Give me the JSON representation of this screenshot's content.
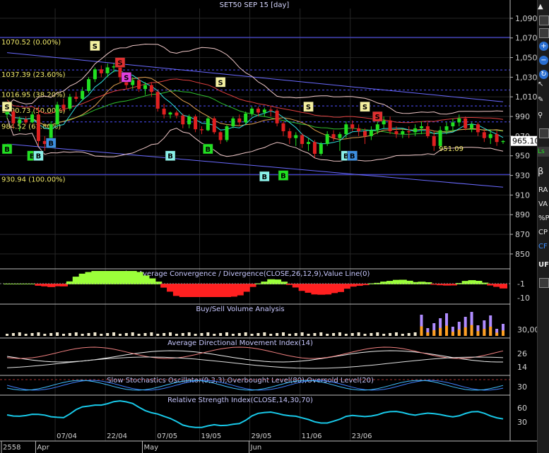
{
  "chart_data": {
    "type": "candlestick",
    "title": "SET50 SEP 15   [day]",
    "price_ylim": [
      837,
      1100
    ],
    "price_ticks": [
      1090,
      1070,
      1050,
      1030,
      1010,
      990,
      970,
      950,
      930,
      910,
      890,
      870,
      850
    ],
    "last_price": "965.10",
    "low_annotation": "951.09",
    "fib_levels": [
      {
        "price": 1070.52,
        "label": "1070.52 (0.00%)"
      },
      {
        "price": 1037.39,
        "label": "1037.39 (23.60%)"
      },
      {
        "price": 1016.9,
        "label": "1016.95 (38.20%)"
      },
      {
        "price": 1000.73,
        "label": "1000.73 (50.00%)"
      },
      {
        "price": 984.52,
        "label": "984.52 (61.80%)"
      },
      {
        "price": 930.94,
        "label": "930.94 (100.00%)"
      }
    ],
    "candles": [
      [
        992,
        998,
        988,
        995
      ],
      [
        995,
        997,
        978,
        983
      ],
      [
        983,
        990,
        975,
        987
      ],
      [
        987,
        990,
        982,
        984
      ],
      [
        984,
        995,
        983,
        992
      ],
      [
        992,
        1000,
        960,
        965
      ],
      [
        965,
        970,
        955,
        962
      ],
      [
        962,
        985,
        960,
        982
      ],
      [
        982,
        1005,
        979,
        1002
      ],
      [
        1002,
        1008,
        995,
        998
      ],
      [
        998,
        1013,
        996,
        1010
      ],
      [
        1010,
        1015,
        1005,
        1008
      ],
      [
        1008,
        1020,
        1006,
        1016
      ],
      [
        1016,
        1030,
        1014,
        1028
      ],
      [
        1028,
        1040,
        1025,
        1038
      ],
      [
        1038,
        1042,
        1030,
        1034
      ],
      [
        1034,
        1044,
        1030,
        1040
      ],
      [
        1040,
        1044,
        1035,
        1041
      ],
      [
        1041,
        1042,
        1025,
        1030
      ],
      [
        1030,
        1034,
        1018,
        1022
      ],
      [
        1022,
        1030,
        1018,
        1027
      ],
      [
        1027,
        1030,
        1015,
        1018
      ],
      [
        1018,
        1025,
        1012,
        1022
      ],
      [
        1022,
        1025,
        1010,
        1015
      ],
      [
        1015,
        1017,
        995,
        998
      ],
      [
        998,
        1003,
        988,
        992
      ],
      [
        992,
        995,
        988,
        994
      ],
      [
        994,
        996,
        988,
        991
      ],
      [
        991,
        993,
        978,
        982
      ],
      [
        982,
        992,
        978,
        990
      ],
      [
        990,
        992,
        974,
        977
      ],
      [
        977,
        980,
        972,
        976
      ],
      [
        976,
        990,
        975,
        988
      ],
      [
        988,
        990,
        972,
        974
      ],
      [
        974,
        975,
        962,
        966
      ],
      [
        966,
        982,
        964,
        980
      ],
      [
        980,
        990,
        978,
        988
      ],
      [
        988,
        992,
        980,
        984
      ],
      [
        984,
        995,
        982,
        993
      ],
      [
        993,
        1000,
        990,
        998
      ],
      [
        998,
        1000,
        990,
        994
      ],
      [
        994,
        999,
        990,
        997
      ],
      [
        997,
        1000,
        990,
        996
      ],
      [
        996,
        998,
        980,
        983
      ],
      [
        983,
        985,
        970,
        975
      ],
      [
        975,
        978,
        962,
        968
      ],
      [
        968,
        974,
        960,
        971
      ],
      [
        971,
        973,
        958,
        962
      ],
      [
        962,
        968,
        955,
        964
      ],
      [
        964,
        966,
        948,
        952
      ],
      [
        952,
        964,
        950,
        962
      ],
      [
        962,
        975,
        960,
        972
      ],
      [
        972,
        976,
        965,
        968
      ],
      [
        968,
        974,
        955,
        972
      ],
      [
        972,
        985,
        968,
        982
      ],
      [
        982,
        986,
        975,
        978
      ],
      [
        978,
        982,
        970,
        975
      ],
      [
        975,
        978,
        962,
        970
      ],
      [
        970,
        980,
        966,
        976
      ],
      [
        976,
        986,
        972,
        982
      ],
      [
        982,
        990,
        978,
        986
      ],
      [
        986,
        990,
        972,
        975
      ],
      [
        975,
        980,
        968,
        972
      ],
      [
        972,
        978,
        968,
        975
      ],
      [
        975,
        980,
        968,
        974
      ],
      [
        974,
        982,
        970,
        978
      ],
      [
        978,
        985,
        972,
        980
      ],
      [
        980,
        984,
        968,
        970
      ],
      [
        970,
        975,
        955,
        960
      ],
      [
        960,
        980,
        958,
        976
      ],
      [
        976,
        984,
        972,
        980
      ],
      [
        980,
        988,
        975,
        984
      ],
      [
        984,
        992,
        980,
        988
      ],
      [
        988,
        990,
        976,
        978
      ],
      [
        978,
        984,
        974,
        982
      ],
      [
        982,
        984,
        970,
        974
      ],
      [
        974,
        978,
        964,
        968
      ],
      [
        968,
        976,
        962,
        972
      ],
      [
        972,
        976,
        960,
        964
      ],
      [
        964,
        966,
        962,
        965
      ]
    ],
    "signals": [
      {
        "i": 0,
        "t": "S",
        "c": "#f4f0a0",
        "pos": "above",
        "price": 1000
      },
      {
        "i": 0,
        "t": "B",
        "c": "#21e021",
        "pos": "below",
        "price": 957
      },
      {
        "i": 4,
        "t": "B",
        "c": "#21e021",
        "pos": "below",
        "price": 950
      },
      {
        "i": 5,
        "t": "B",
        "c": "#8af0e8",
        "pos": "below",
        "price": 950
      },
      {
        "i": 7,
        "t": "B",
        "c": "#3d8fe0",
        "pos": "below",
        "price": 963
      },
      {
        "i": 14,
        "t": "S",
        "c": "#f4f0a0",
        "pos": "above",
        "price": 1062
      },
      {
        "i": 18,
        "t": "S",
        "c": "#e03030",
        "pos": "above",
        "price": 1045
      },
      {
        "i": 19,
        "t": "S",
        "c": "#e040e0",
        "pos": "above",
        "price": 1030
      },
      {
        "i": 26,
        "t": "B",
        "c": "#8af0e8",
        "pos": "below",
        "price": 950
      },
      {
        "i": 32,
        "t": "B",
        "c": "#21e021",
        "pos": "below",
        "price": 957
      },
      {
        "i": 34,
        "t": "S",
        "c": "#f4f0a0",
        "pos": "above",
        "price": 1025
      },
      {
        "i": 41,
        "t": "B",
        "c": "#8af0e8",
        "pos": "below",
        "price": 929
      },
      {
        "i": 44,
        "t": "B",
        "c": "#21e021",
        "pos": "below",
        "price": 930
      },
      {
        "i": 48,
        "t": "S",
        "c": "#f4f0a0",
        "pos": "above",
        "price": 1000
      },
      {
        "i": 54,
        "t": "B",
        "c": "#8af0e8",
        "pos": "below",
        "price": 950
      },
      {
        "i": 55,
        "t": "B",
        "c": "#3d8fe0",
        "pos": "below",
        "price": 950
      },
      {
        "i": 57,
        "t": "S",
        "c": "#f4f0a0",
        "pos": "above",
        "price": 1000
      },
      {
        "i": 59,
        "t": "S",
        "c": "#e03030",
        "pos": "above",
        "price": 990
      }
    ],
    "x_labels": [
      "07/04",
      "22/04",
      "07/05",
      "19/05",
      "29/05",
      "11/06",
      "23/06"
    ],
    "x_label_index": [
      8,
      16,
      24,
      31,
      39,
      47,
      55
    ],
    "bottom_labels": [
      "2558",
      "Apr",
      "May",
      "Jun"
    ],
    "bottom_label_index": [
      0,
      5,
      22,
      39
    ],
    "panels": {
      "macd": {
        "title": "Moving Average Convergence / Divergence(CLOSE,26,12,9),Value Line(0)",
        "ticks": [
          "-1",
          "-10"
        ]
      },
      "volume": {
        "title": "Buy/Sell Volume Analysis",
        "ticks": [
          "30,00"
        ]
      },
      "adx": {
        "title": "Average Directional Movement Index(14)",
        "ticks": [
          "26",
          "14"
        ]
      },
      "stoch": {
        "title": "Slow Stochastics Oscillator(9,3,3),Overbought Level(80),Oversold Level(20)",
        "ticks": [
          "30"
        ]
      },
      "rsi": {
        "title": "Relative Strength Index(CLOSE,14,30,70)",
        "ticks": [
          "60",
          "30"
        ]
      }
    },
    "colors": {
      "up": "#21e021",
      "down": "#e02020",
      "grid": "#262626",
      "axis": "#d0d0d0",
      "fib": "#5050ff",
      "trend": "#6060ff",
      "macd_pos": "#9cff3a",
      "macd_neg": "#ff2020",
      "rsi": "#18c8e8"
    }
  },
  "toolbar": {
    "items": [
      "RA",
      "VA",
      "%P",
      "CP",
      "CF",
      "UF"
    ]
  }
}
